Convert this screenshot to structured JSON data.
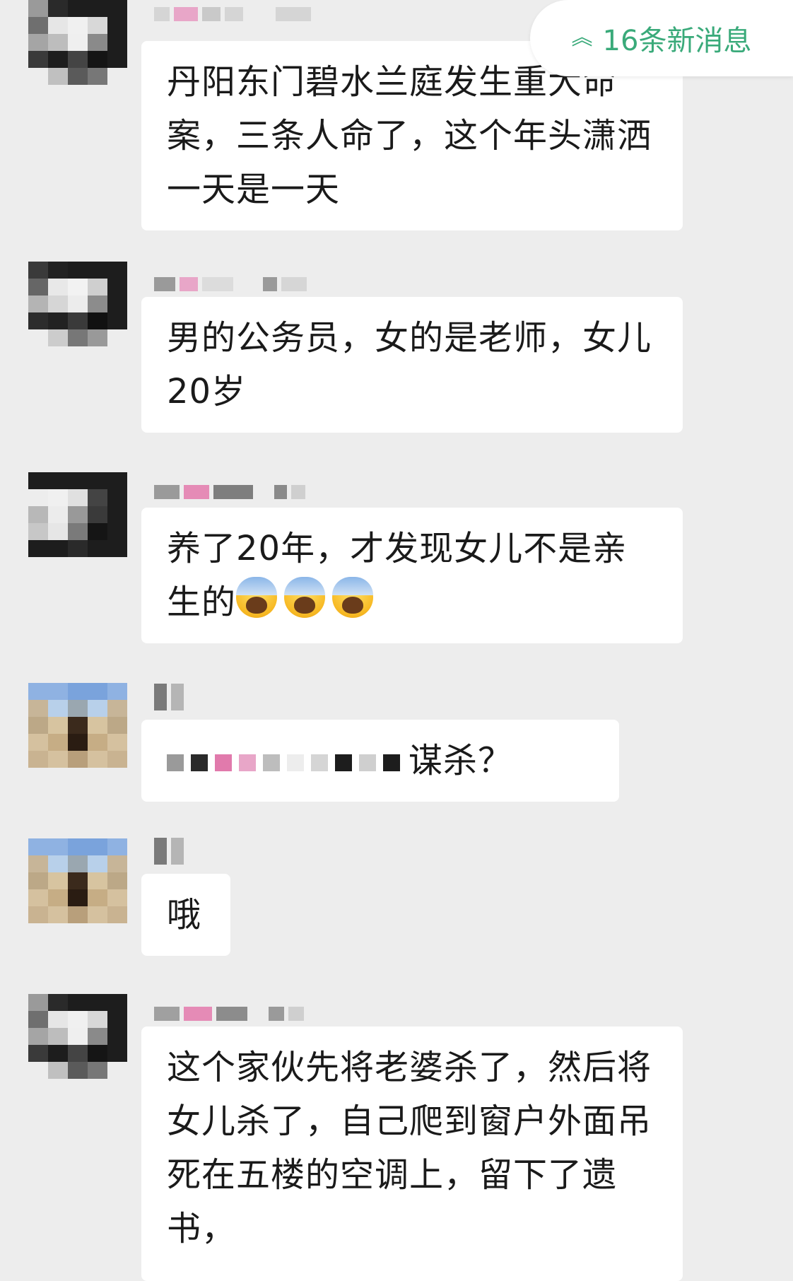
{
  "new_messages_badge": {
    "label": "16条新消息",
    "icon": "double-chevron-up-icon",
    "color": "#3aaa7a"
  },
  "messages": [
    {
      "sender_name": "",
      "text": "丹阳东门碧水兰庭发生重大命案，三条人命了，这个年头潇洒一天是一天"
    },
    {
      "sender_name": "",
      "text": "男的公务员，女的是老师，女儿20岁"
    },
    {
      "sender_name": "",
      "text": "养了20年，才发现女儿不是亲生的"
    },
    {
      "sender_name": "",
      "text": "谋杀？"
    },
    {
      "sender_name": "",
      "text": "哦"
    },
    {
      "sender_name": "",
      "text": "这个家伙先将老婆杀了，然后将女儿杀了，自己爬到窗户外面吊死在五楼的空调上，留下了遗书，"
    }
  ]
}
